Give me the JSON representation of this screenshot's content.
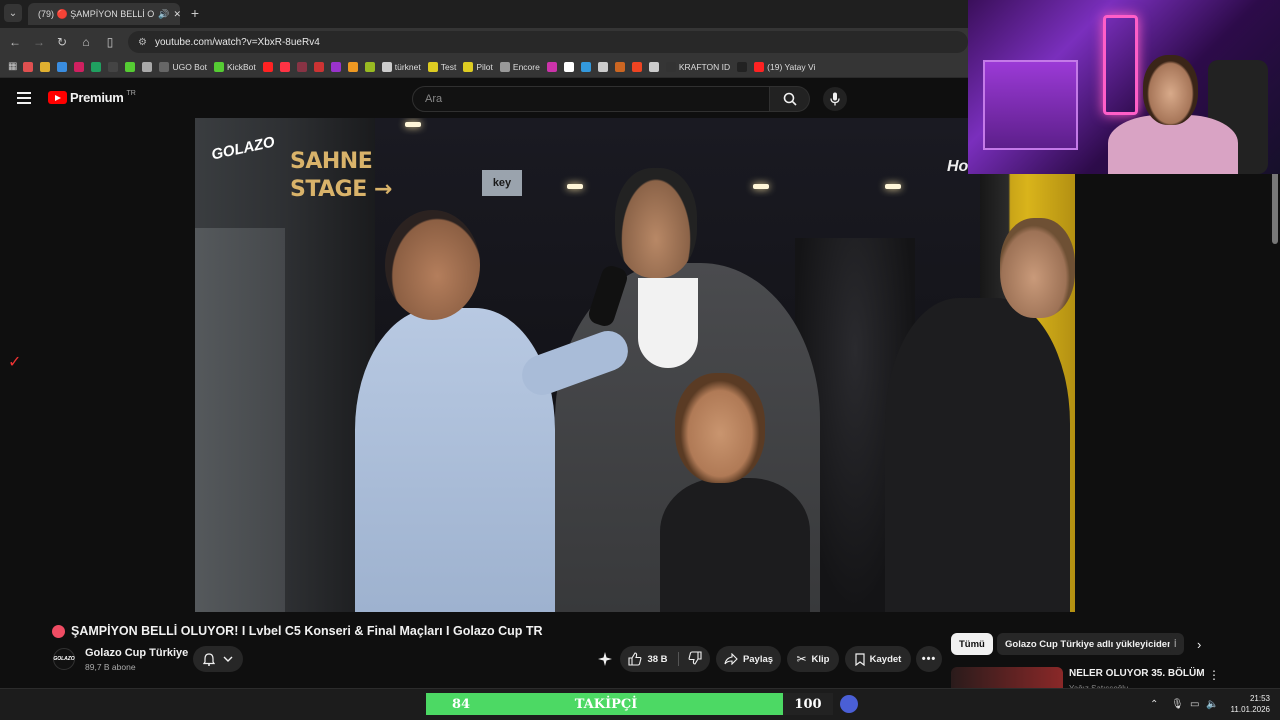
{
  "browser": {
    "tab_title": "(79) 🔴 ŞAMPİYON BELLİ O",
    "url": "youtube.com/watch?v=XbxR-8ueRv4"
  },
  "bookmarks": [
    {
      "label": "",
      "color": "#e05050"
    },
    {
      "label": "",
      "color": "#e0b030"
    },
    {
      "label": "",
      "color": "#3a8de0"
    },
    {
      "label": "",
      "color": "#d02060"
    },
    {
      "label": "",
      "color": "#20a060"
    },
    {
      "label": "",
      "color": "#444444"
    },
    {
      "label": "",
      "color": "#55cc33"
    },
    {
      "label": "",
      "color": "#aaaaaa"
    },
    {
      "label": "UGO Bot",
      "color": "#666666"
    },
    {
      "label": "KickBot",
      "color": "#55cc33"
    },
    {
      "label": "",
      "color": "#ff2222"
    },
    {
      "label": "",
      "color": "#ff3344"
    },
    {
      "label": "",
      "color": "#883344"
    },
    {
      "label": "",
      "color": "#cc3333"
    },
    {
      "label": "",
      "color": "#9933cc"
    },
    {
      "label": "",
      "color": "#ee9922"
    },
    {
      "label": "",
      "color": "#99bb22"
    },
    {
      "label": "türknet",
      "color": "#cccccc"
    },
    {
      "label": "Test",
      "color": "#ddcc22"
    },
    {
      "label": "Pilot",
      "color": "#ddcc22"
    },
    {
      "label": "Encore",
      "color": "#999999"
    },
    {
      "label": "",
      "color": "#cc33aa"
    },
    {
      "label": "",
      "color": "#ffffff"
    },
    {
      "label": "",
      "color": "#3399dd"
    },
    {
      "label": "",
      "color": "#cccccc"
    },
    {
      "label": "",
      "color": "#cc6622"
    },
    {
      "label": "",
      "color": "#ee4422"
    },
    {
      "label": "",
      "color": "#cccccc"
    },
    {
      "label": "KRAFTON ID",
      "color": "#333333"
    },
    {
      "label": "",
      "color": "#222222"
    },
    {
      "label": "(19) Yatay Vi",
      "color": "#ff2222"
    }
  ],
  "youtube": {
    "logo_text": "Premium",
    "logo_region": "TR",
    "search_placeholder": "Ara"
  },
  "video": {
    "watermark": "GOLAZO",
    "stage_sign_line1": "SAHNE",
    "stage_sign_line2": "STAGE →",
    "key_sign": "key",
    "corner_sign": "Hotel"
  },
  "watch": {
    "title": "ŞAMPİYON BELLİ OLUYOR! I Lvbel C5 Konseri & Final Maçları I Golazo Cup TR",
    "channel_name": "Golazo Cup Türkiye",
    "subscribers": "89,7 B abone",
    "channel_avatar_text": "GOLAZO",
    "like_count": "38 B",
    "share_label": "Paylaş",
    "clip_label": "Klip",
    "save_label": "Kaydet"
  },
  "related": {
    "chips": [
      "Tümü",
      "Golazo Cup Türkiye adlı yükleyiciden",
      "İ"
    ],
    "first_title": "NELER OLUYOR 35. BÖLÜM",
    "first_channel": "Yağız Satışsoğlu"
  },
  "overlay": {
    "follower_current": "84",
    "follower_label": "TAKİPÇİ",
    "follower_goal": "100"
  },
  "taskbar": {
    "time": "21:53",
    "date": "11.01.2026"
  }
}
